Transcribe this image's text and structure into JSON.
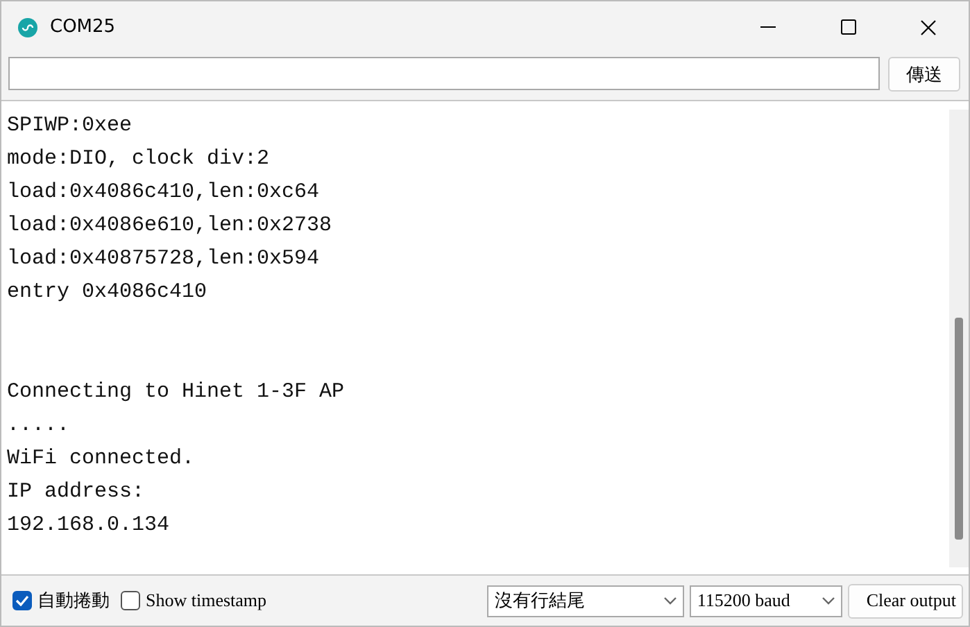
{
  "window": {
    "title": "COM25"
  },
  "send_button": "傳送",
  "output_blocks": [
    {
      "lines": [
        "SPIWP:0xee",
        "mode:DIO, clock div:2",
        "load:0x4086c410,len:0xc64",
        "load:0x4086e610,len:0x2738",
        "load:0x40875728,len:0x594",
        "entry 0x4086c410"
      ]
    },
    {
      "lines": [
        "Connecting to Hinet 1-3F AP",
        ".....",
        "WiFi connected.",
        "IP address:",
        "192.168.0.134"
      ]
    }
  ],
  "autoscroll": {
    "label": "自動捲動",
    "checked": true
  },
  "timestamp": {
    "label": "Show timestamp",
    "checked": false
  },
  "line_ending": "沒有行結尾",
  "baud": "115200 baud",
  "clear_button": "Clear output"
}
